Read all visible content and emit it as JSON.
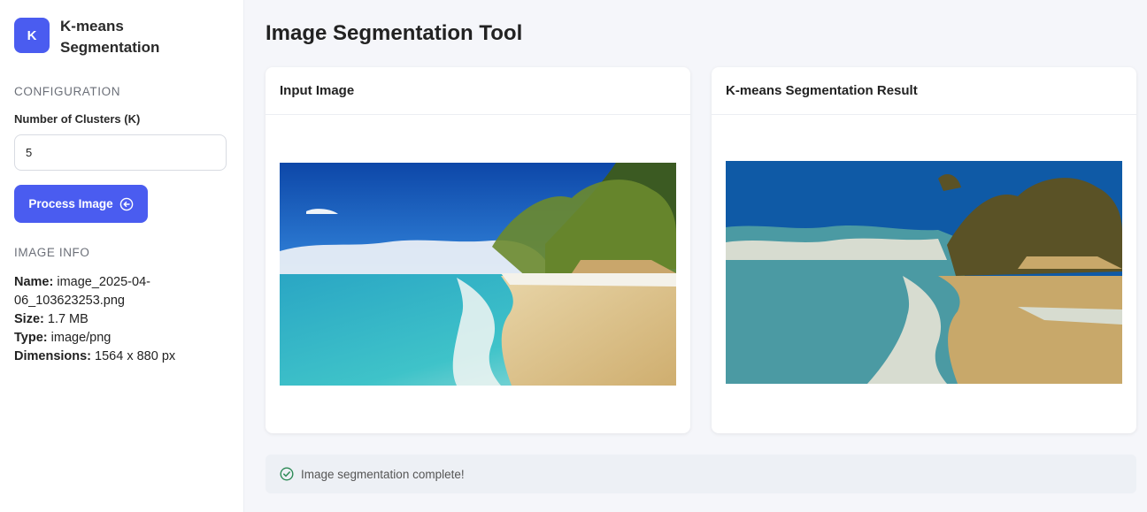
{
  "sidebar": {
    "logo_letter": "K",
    "app_title": "K-means Segmentation",
    "config_heading": "CONFIGURATION",
    "clusters_label": "Number of Clusters (K)",
    "clusters_value": "5",
    "process_button": "Process Image",
    "info_heading": "IMAGE INFO",
    "info": {
      "name_label": "Name:",
      "name_value": "image_2025-04-06_103623253.png",
      "size_label": "Size:",
      "size_value": "1.7 MB",
      "type_label": "Type:",
      "type_value": "image/png",
      "dimensions_label": "Dimensions:",
      "dimensions_value": "1564 x 880 px"
    }
  },
  "main": {
    "title": "Image Segmentation Tool",
    "input_card_title": "Input Image",
    "result_card_title": "K-means Segmentation Result",
    "status_message": "Image segmentation complete!"
  },
  "colors": {
    "accent": "#4a5cf0",
    "success": "#2e8b57"
  },
  "icons": {
    "process": "arrow-left-circle-icon",
    "status": "check-circle-icon"
  }
}
